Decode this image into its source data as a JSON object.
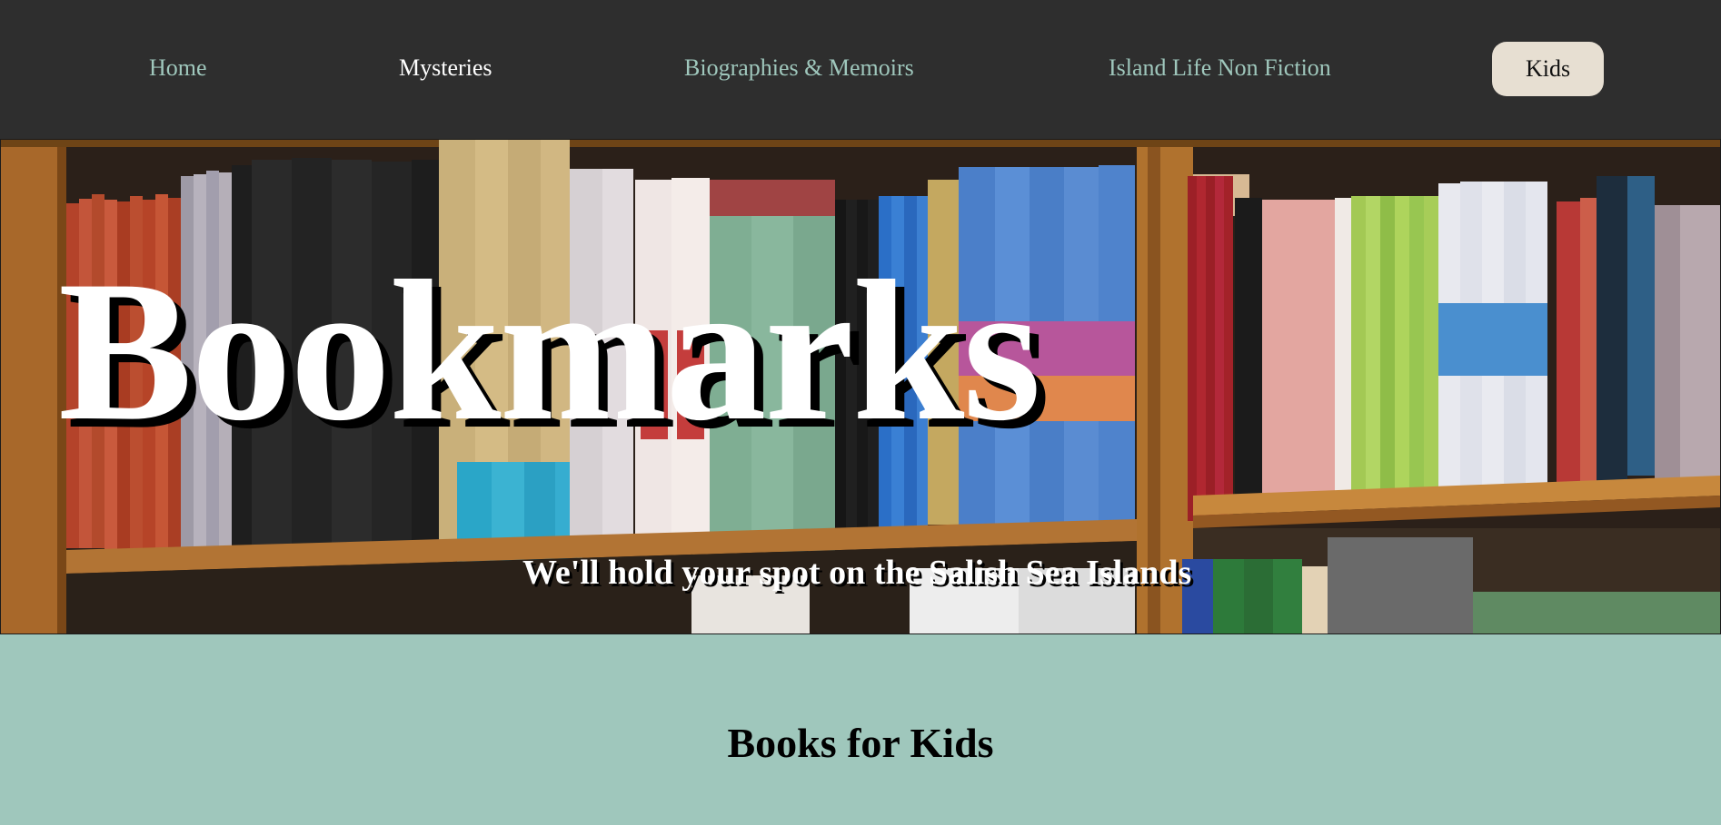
{
  "nav": {
    "items": [
      {
        "label": "Home"
      },
      {
        "label": "Mysteries"
      },
      {
        "label": "Biographies & Memoirs"
      },
      {
        "label": "Island Life Non Fiction"
      },
      {
        "label": "Kids"
      }
    ],
    "active": "Kids"
  },
  "hero": {
    "title": "Bookmarks",
    "subtitle": "We'll hold your spot on the Salish Sea Islands",
    "background": "photo of a wooden bookshelf filled with paperback books"
  },
  "section": {
    "heading": "Books for Kids"
  },
  "colors": {
    "nav_background": "#2e2e2e",
    "accent": "#9fc7bc",
    "active_pill": "#e7dfd2",
    "page_background": "#9fc7bc"
  }
}
